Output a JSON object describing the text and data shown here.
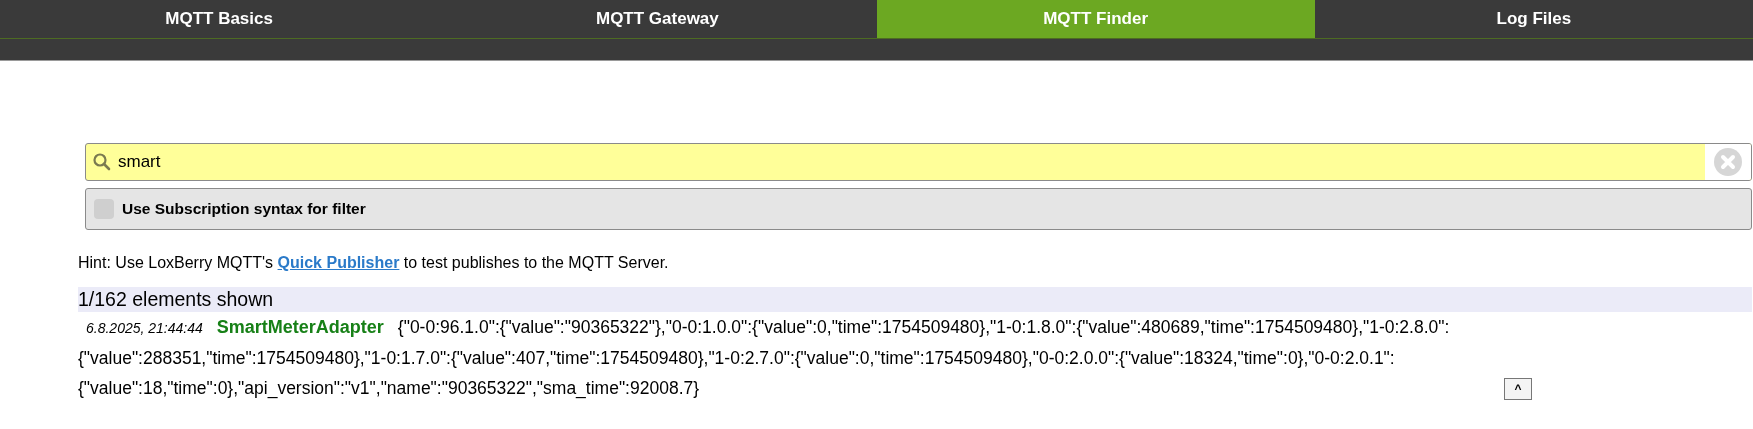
{
  "tabs": [
    {
      "label": "MQTT Basics",
      "selected": false
    },
    {
      "label": "MQTT Gateway",
      "selected": false
    },
    {
      "label": "MQTT Finder",
      "selected": true
    },
    {
      "label": "Log Files",
      "selected": false
    }
  ],
  "search": {
    "value": "smart"
  },
  "subscription_syntax": {
    "label": "Use Subscription syntax for filter",
    "checked": false
  },
  "hint": {
    "before": "Hint: Use LoxBerry MQTT's",
    "link": "Quick Publisher",
    "after": "to test publishes to the MQTT Server."
  },
  "count": "1/162 elements shown",
  "entries": [
    {
      "time": "6.8.2025, 21:44:44",
      "topic": "SmartMeterAdapter",
      "message": "{\"0-0:96.1.0\":{\"value\":\"90365322\"},\"0-0:1.0.0\":{\"value\":0,\"time\":1754509480},\"1-0:1.8.0\":{\"value\":480689,\"time\":1754509480},\"1-0:2.8.0\":{\"value\":288351,\"time\":1754509480},\"1-0:1.7.0\":{\"value\":407,\"time\":1754509480},\"1-0:2.7.0\":{\"value\":0,\"time\":1754509480},\"0-0:2.0.0\":{\"value\":18324,\"time\":0},\"0-0:2.0.1\":{\"value\":18,\"time\":0},\"api_version\":\"v1\",\"name\":\"90365322\",\"sma_time\":92008.7}",
      "toggle": "^"
    }
  ]
}
